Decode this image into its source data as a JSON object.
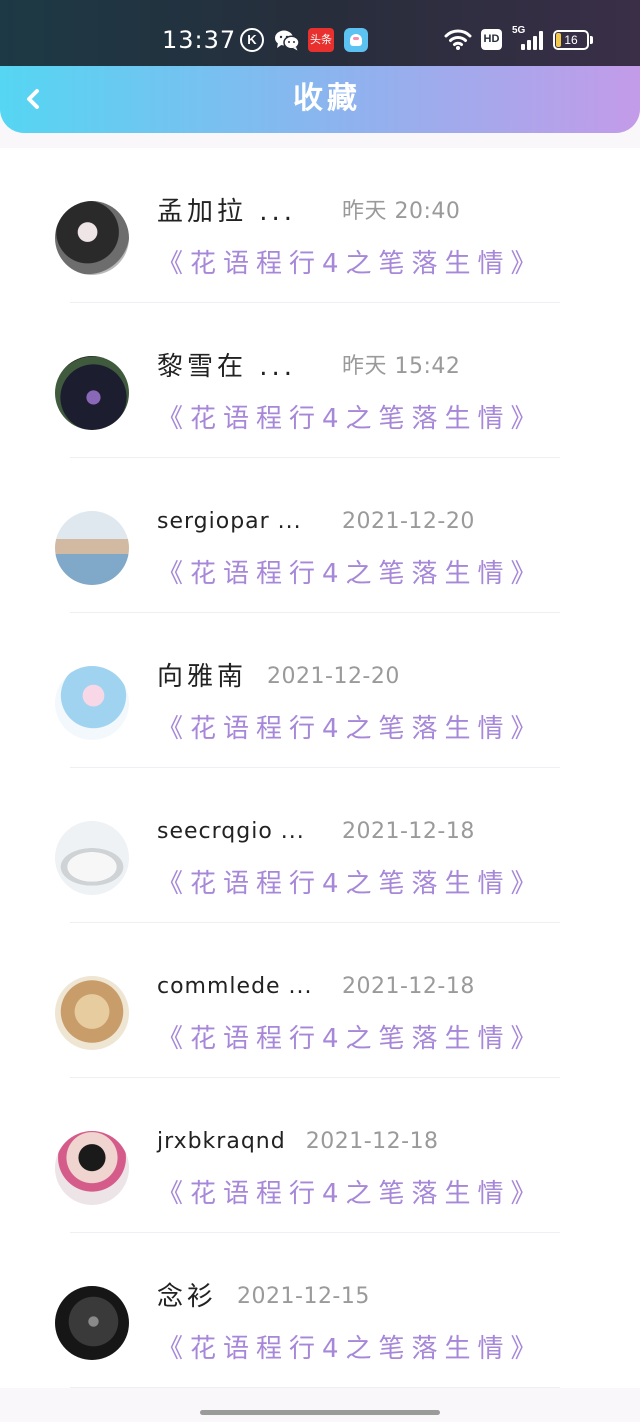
{
  "status_bar": {
    "time": "13:37",
    "k_logo": "K",
    "toutiao_label": "头条",
    "hd_label": "HD",
    "network_label": "5G",
    "battery_level": "16",
    "icons": [
      "k-app-icon",
      "wechat-icon",
      "toutiao-icon",
      "app-icon",
      "wifi-icon",
      "hd-icon",
      "signal-icon",
      "battery-icon"
    ]
  },
  "header": {
    "back_icon": "chevron-left-icon",
    "title": "收藏"
  },
  "theme": {
    "status_bar_bg": "#272d3b",
    "header_gradient_start": "#55d6f2",
    "header_gradient_end": "#c39be9",
    "name_color": "#222222",
    "date_color": "#9a9a9a",
    "work_title_color": "#a687d8"
  },
  "favorites": {
    "items": [
      {
        "name": "孟加拉 ...",
        "time": "昨天 20:40",
        "work_title": "《花语程行4之笔落生情》"
      },
      {
        "name": "黎雪在 ...",
        "time": "昨天 15:42",
        "work_title": "《花语程行4之笔落生情》"
      },
      {
        "name": "sergiopar ...",
        "time": "2021-12-20",
        "work_title": "《花语程行4之笔落生情》"
      },
      {
        "name": "向雅南",
        "time": "2021-12-20",
        "work_title": "《花语程行4之笔落生情》"
      },
      {
        "name": "seecrqgio ...",
        "time": "2021-12-18",
        "work_title": "《花语程行4之笔落生情》"
      },
      {
        "name": "commlede ...",
        "time": "2021-12-18",
        "work_title": "《花语程行4之笔落生情》"
      },
      {
        "name": "jrxbkraqnd",
        "time": "2021-12-18",
        "work_title": "《花语程行4之笔落生情》"
      },
      {
        "name": "念衫",
        "time": "2021-12-15",
        "work_title": "《花语程行4之笔落生情》"
      }
    ]
  }
}
